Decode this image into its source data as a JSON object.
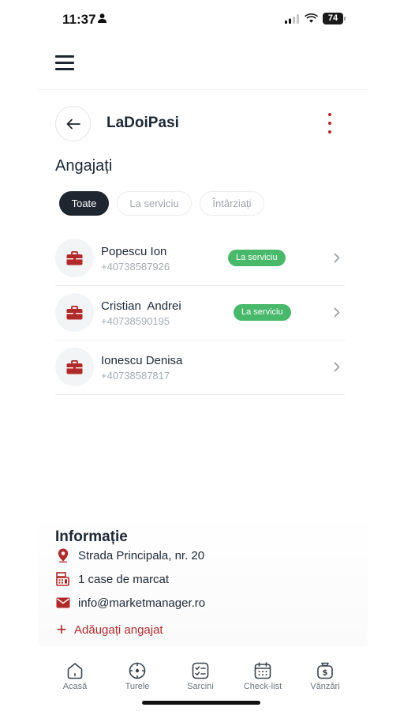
{
  "status_bar": {
    "time": "11:37",
    "battery": "74"
  },
  "header": {
    "store_name": "LaDoiPasi"
  },
  "employees_section": {
    "title": "Angajați",
    "filters": [
      "Toate",
      "La serviciu",
      "Întârziați"
    ],
    "selected_filter": "Toate"
  },
  "employees": [
    {
      "name": "Popescu Ion",
      "phone": "+40738587926",
      "status": "La serviciu"
    },
    {
      "name": "Cristian  Andrei",
      "phone": "+40738590195",
      "status": "La serviciu"
    },
    {
      "name": "Ionescu Denisa",
      "phone": "+40738587817",
      "status": ""
    }
  ],
  "info": {
    "title": "Informație",
    "address": "Strada Principala, nr. 20",
    "registers": "1 case de marcat",
    "email": "info@marketmanager.ro",
    "add_employee": "Adăugați angajat"
  },
  "bottom_nav": [
    "Acasă",
    "Turele",
    "Sarcini",
    "Check-list",
    "Vânzări"
  ],
  "colors": {
    "accent": "#b02a2a",
    "status_green": "#48b86a",
    "dark": "#1f2630"
  }
}
